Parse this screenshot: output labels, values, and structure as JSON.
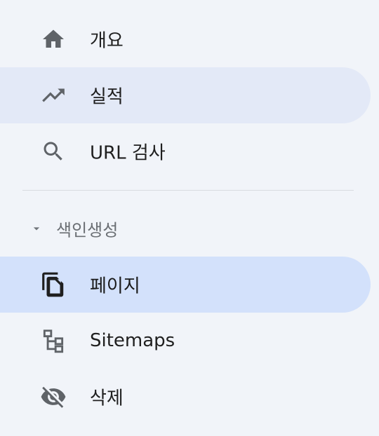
{
  "nav": {
    "items": [
      {
        "label": "개요",
        "icon": "home-icon"
      },
      {
        "label": "실적",
        "icon": "trending-up-icon"
      },
      {
        "label": "URL 검사",
        "icon": "search-icon"
      }
    ],
    "section": {
      "label": "색인생성",
      "caret_icon": "caret-down-icon",
      "items": [
        {
          "label": "페이지",
          "icon": "copy-pages-icon",
          "selected": true
        },
        {
          "label": "Sitemaps",
          "icon": "sitemap-icon"
        },
        {
          "label": "삭제",
          "icon": "visibility-off-icon"
        }
      ]
    }
  },
  "colors": {
    "background": "#f1f4f9",
    "hover": "#e3e9f7",
    "selected": "#d3e1fb",
    "icon": "#5f6368",
    "text": "#1f1f1f"
  }
}
